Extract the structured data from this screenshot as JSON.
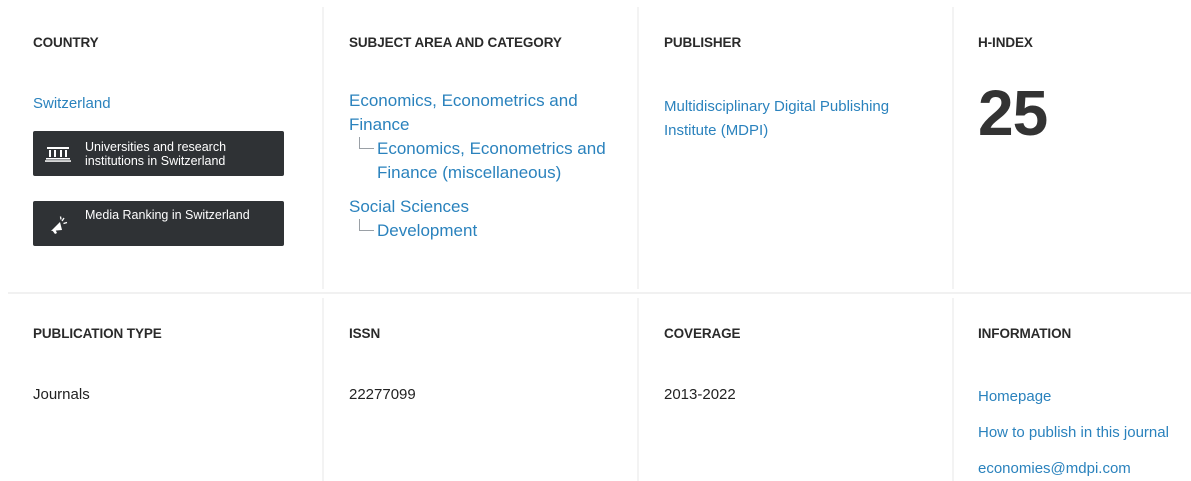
{
  "country": {
    "heading": "COUNTRY",
    "value": "Switzerland",
    "buttons": [
      {
        "label_line1": "Universities and research",
        "label_line2": "institutions in Switzerland",
        "icon": "institution-icon"
      },
      {
        "label": "Media Ranking in Switzerland",
        "icon": "megaphone-icon"
      }
    ]
  },
  "subject": {
    "heading": "SUBJECT AREA AND CATEGORY",
    "areas": [
      {
        "name": "Economics, Econometrics and Finance",
        "categories": [
          "Economics, Econometrics and Finance (miscellaneous)"
        ]
      },
      {
        "name": "Social Sciences",
        "categories": [
          "Development"
        ]
      }
    ]
  },
  "publisher": {
    "heading": "PUBLISHER",
    "name": "Multidisciplinary Digital Publishing Institute (MDPI)"
  },
  "hindex": {
    "heading": "H-INDEX",
    "value": "25"
  },
  "publication_type": {
    "heading": "PUBLICATION TYPE",
    "value": "Journals"
  },
  "issn": {
    "heading": "ISSN",
    "value": "22277099"
  },
  "coverage": {
    "heading": "COVERAGE",
    "value": "2013-2022"
  },
  "information": {
    "heading": "INFORMATION",
    "links": [
      "Homepage",
      "How to publish in this journal",
      "economies@mdpi.com"
    ]
  },
  "colors": {
    "link": "#2a82bd",
    "button_bg": "#2f3235",
    "divider": "#f1f1f1"
  }
}
